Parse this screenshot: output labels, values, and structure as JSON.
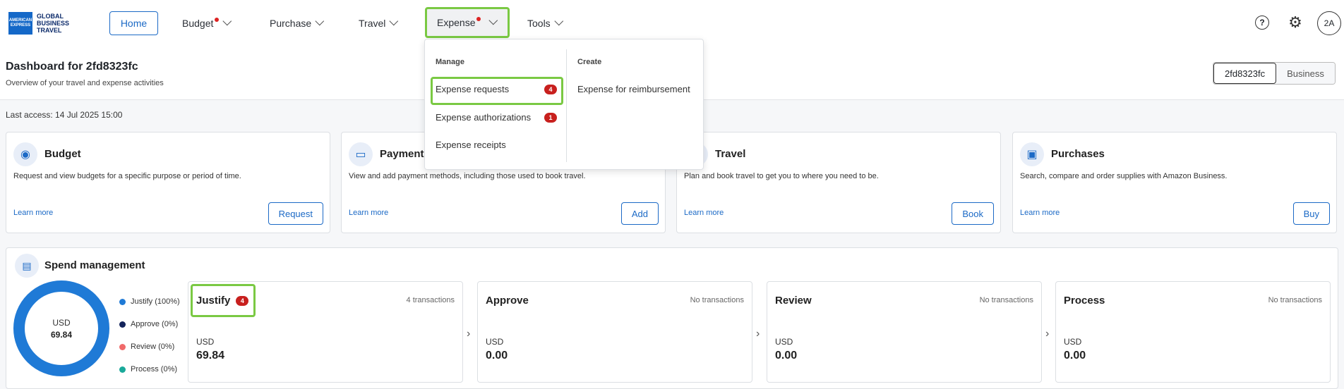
{
  "brand": {
    "logo_box_text": "AMERICAN EXPRESS",
    "name_line1": "GLOBAL",
    "name_line2": "BUSINESS",
    "name_line3": "TRAVEL"
  },
  "nav": {
    "home": "Home",
    "budget": "Budget",
    "purchase": "Purchase",
    "travel": "Travel",
    "expense": "Expense",
    "tools": "Tools",
    "avatar": "2A"
  },
  "header": {
    "title": "Dashboard for 2fd8323fc",
    "subtitle": "Overview of your travel and expense activities",
    "segments": [
      "2fd8323fc",
      "Business"
    ]
  },
  "last_access": "Last access: 14 Jul 2025 15:00",
  "cards": [
    {
      "title": "Budget",
      "desc": "Request and view budgets for a specific purpose or period of time.",
      "learn": "Learn more",
      "button": "Request"
    },
    {
      "title": "Payment",
      "desc": "View and add payment methods, including those used to book travel.",
      "learn": "Learn more",
      "button": "Add"
    },
    {
      "title": "Travel",
      "desc": "Plan and book travel to get you to where you need to be.",
      "learn": "Learn more",
      "button": "Book"
    },
    {
      "title": "Purchases",
      "desc": "Search, compare and order supplies with Amazon Business.",
      "learn": "Learn more",
      "button": "Buy"
    }
  ],
  "spend": {
    "title": "Spend management",
    "donut_currency": "USD",
    "donut_value": "69.84",
    "legend": [
      {
        "label": "Justify (100%)",
        "color": "#1f7ad6"
      },
      {
        "label": "Approve (0%)",
        "color": "#13235b"
      },
      {
        "label": "Review (0%)",
        "color": "#f06a6a"
      },
      {
        "label": "Process (0%)",
        "color": "#1aa99a"
      }
    ],
    "stages": [
      {
        "name": "Justify",
        "badge": "4",
        "count": "4 transactions",
        "currency": "USD",
        "amount": "69.84"
      },
      {
        "name": "Approve",
        "count": "No transactions",
        "currency": "USD",
        "amount": "0.00"
      },
      {
        "name": "Review",
        "count": "No transactions",
        "currency": "USD",
        "amount": "0.00"
      },
      {
        "name": "Process",
        "count": "No transactions",
        "currency": "USD",
        "amount": "0.00"
      }
    ]
  },
  "expense_menu": {
    "manage_heading": "Manage",
    "create_heading": "Create",
    "manage_items": [
      {
        "label": "Expense requests",
        "badge": "4"
      },
      {
        "label": "Expense authorizations",
        "badge": "1"
      },
      {
        "label": "Expense receipts"
      }
    ],
    "create_items": [
      {
        "label": "Expense for reimbursement"
      }
    ]
  }
}
